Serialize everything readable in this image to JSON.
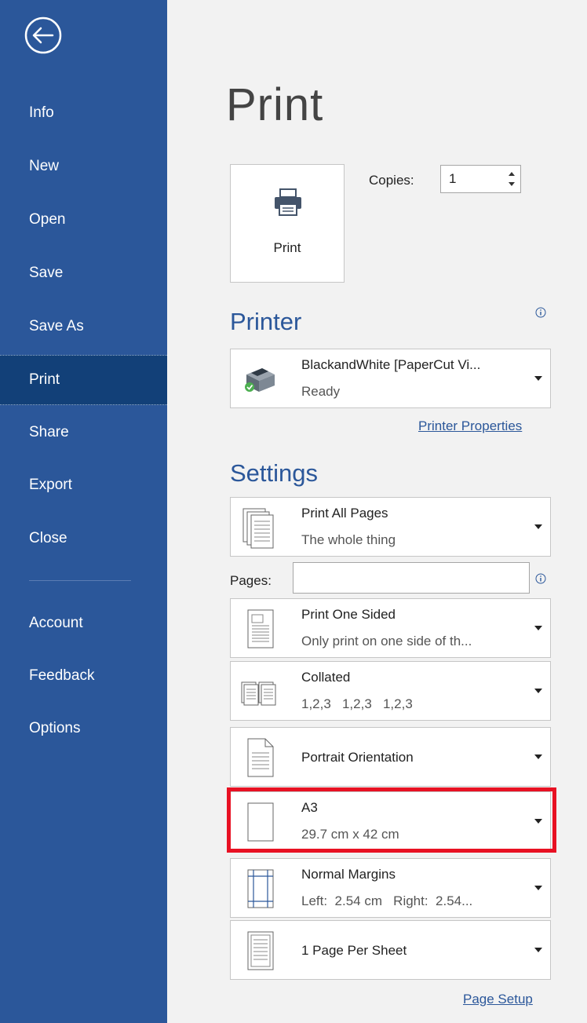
{
  "sidebar": {
    "items": [
      {
        "label": "Info"
      },
      {
        "label": "New"
      },
      {
        "label": "Open"
      },
      {
        "label": "Save"
      },
      {
        "label": "Save As"
      },
      {
        "label": "Print",
        "selected": true
      },
      {
        "label": "Share"
      },
      {
        "label": "Export"
      },
      {
        "label": "Close"
      },
      {
        "label": "Account"
      },
      {
        "label": "Feedback"
      },
      {
        "label": "Options"
      }
    ]
  },
  "page": {
    "title": "Print"
  },
  "print_button": {
    "label": "Print"
  },
  "copies": {
    "label": "Copies:",
    "value": "1"
  },
  "printer": {
    "heading": "Printer",
    "name": "BlackandWhite [PaperCut Vi...",
    "status": "Ready",
    "properties_link": "Printer Properties"
  },
  "settings": {
    "heading": "Settings",
    "pages_label": "Pages:",
    "pages_value": "",
    "items": [
      {
        "line1": "Print All Pages",
        "line2": "The whole thing"
      },
      {
        "line1": "Print One Sided",
        "line2": "Only print on one side of th..."
      },
      {
        "line1": "Collated",
        "line2": "1,2,3   1,2,3   1,2,3"
      },
      {
        "line1": "Portrait Orientation",
        "line2": ""
      },
      {
        "line1": "A3",
        "line2": "29.7 cm x 42 cm"
      },
      {
        "line1": "Normal Margins",
        "line2": "Left:  2.54 cm   Right:  2.54..."
      },
      {
        "line1": "1 Page Per Sheet",
        "line2": ""
      }
    ],
    "page_setup_link": "Page Setup"
  },
  "colors": {
    "sidebar": "#2b579a",
    "selected": "#124078",
    "highlight": "#e81123",
    "accent": "#2b579a"
  }
}
